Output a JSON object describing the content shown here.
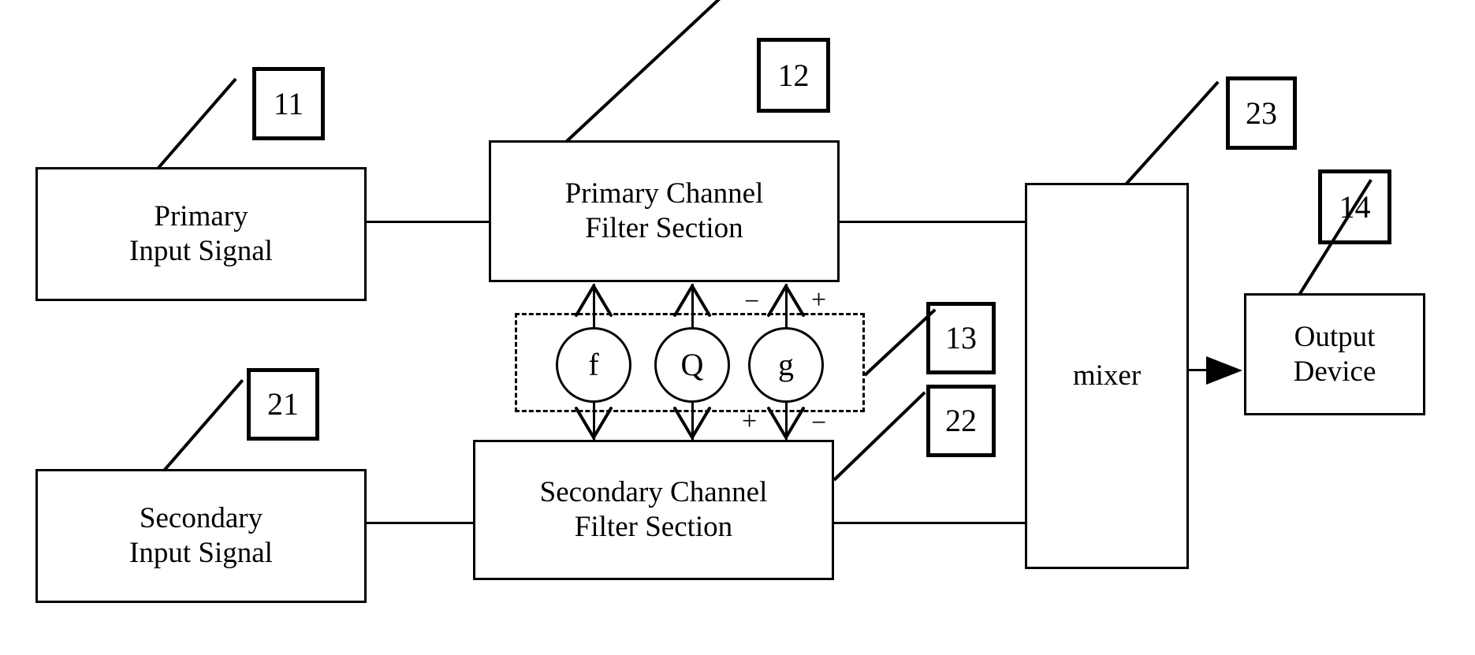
{
  "diagram": {
    "title": "Dual-channel adaptive filter block diagram",
    "line_color": "#000000",
    "background": "#ffffff"
  },
  "blocks": {
    "primary_input": {
      "label": "Primary\nInput Signal"
    },
    "secondary_input": {
      "label": "Secondary\nInput Signal"
    },
    "primary_filter": {
      "label": "Primary Channel\nFilter Section"
    },
    "secondary_filter": {
      "label": "Secondary Channel\nFilter Section"
    },
    "mixer": {
      "label": "mixer"
    },
    "output_device": {
      "label": "Output\nDevice"
    }
  },
  "controls": {
    "frequency": {
      "label": "f"
    },
    "q_factor": {
      "label": "Q"
    },
    "gain": {
      "label": "g"
    },
    "signs": {
      "primary_minus": "−",
      "primary_plus": "+",
      "secondary_plus": "+",
      "secondary_minus": "−"
    }
  },
  "reference_numerals": {
    "primary_input_ref": "11",
    "primary_filter_ref": "12",
    "control_group_ref": "13",
    "output_device_ref": "14",
    "secondary_input_ref": "21",
    "secondary_filter_ref": "22",
    "mixer_ref": "23"
  }
}
